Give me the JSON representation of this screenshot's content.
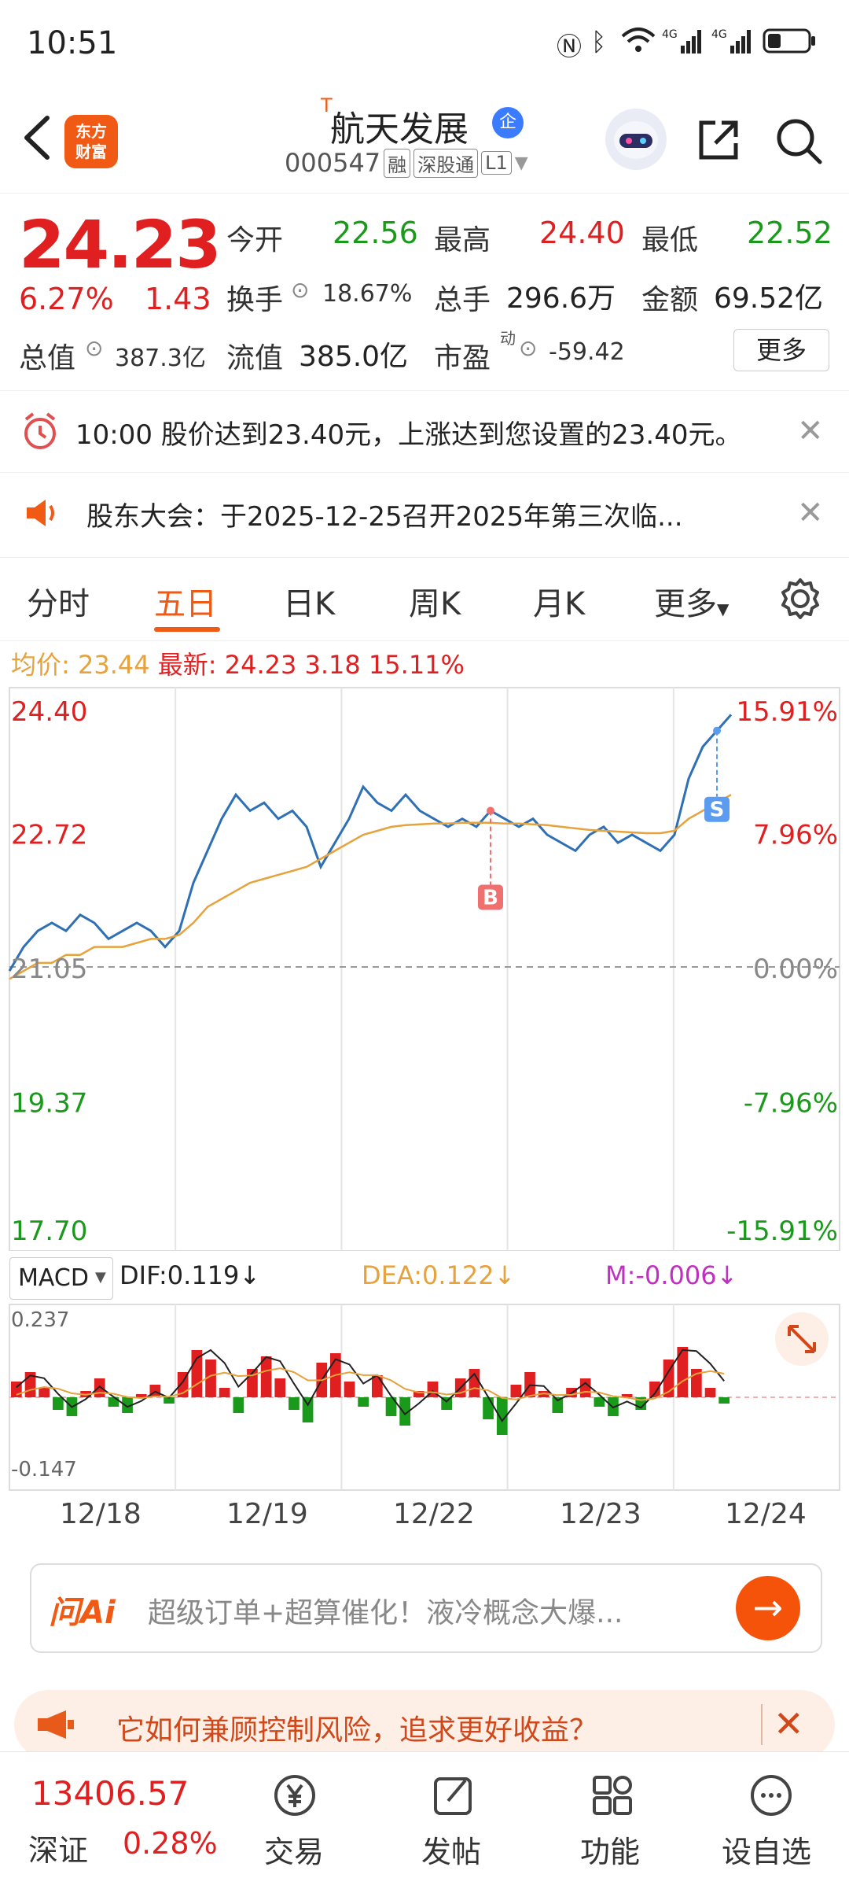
{
  "status_bar": {
    "time": "10:51"
  },
  "header": {
    "title": "航天发展",
    "title_mark": "T",
    "code": "000547",
    "tags": [
      "融",
      "深股通",
      "L1"
    ],
    "logo": "东方财富",
    "corp_badge": "企"
  },
  "quote": {
    "price": "24.23",
    "pct_change": "6.27%",
    "change": "1.43",
    "open_label": "今开",
    "open": "22.56",
    "high_label": "最高",
    "high": "24.40",
    "low_label": "最低",
    "low": "22.52",
    "turnover_label": "换手",
    "turnover": "18.67%",
    "volume_label": "总手",
    "volume": "296.6万",
    "amount_label": "金额",
    "amount": "69.52亿",
    "mktcap_label": "总值",
    "mktcap": "387.3亿",
    "float_label": "流值",
    "float": "385.0亿",
    "pe_label": "市盈",
    "pe_sup": "动",
    "pe": "-59.42",
    "more": "更多"
  },
  "notices": [
    {
      "text": "10:00 股价达到23.40元，上涨达到您设置的23.40元。"
    },
    {
      "text": "股东大会：于2025-12-25召开2025年第三次临..."
    }
  ],
  "tabs": [
    "分时",
    "五日",
    "日K",
    "周K",
    "月K",
    "更多"
  ],
  "chart_info": {
    "avg_label": "均价:",
    "avg": "23.44",
    "latest_label": "最新:",
    "latest": "24.23",
    "change": "3.18",
    "pct": "15.11%"
  },
  "chart_data": {
    "type": "line",
    "title": "",
    "x": [
      "12/18",
      "12/19",
      "12/22",
      "12/23",
      "12/24"
    ],
    "y_ticks_left": [
      "24.40",
      "22.72",
      "21.05",
      "19.37",
      "17.70"
    ],
    "y_ticks_right": [
      "15.91%",
      "7.96%",
      "0.00%",
      "-7.96%",
      "-15.91%"
    ],
    "ylim": [
      17.7,
      24.4
    ],
    "baseline": 21.05,
    "series": [
      {
        "name": "",
        "values": [
          21.0,
          21.3,
          21.5,
          21.6,
          21.5,
          21.7,
          21.6,
          21.4,
          21.5,
          21.6,
          21.5,
          21.3,
          21.5,
          22.1,
          22.5,
          22.9,
          23.2,
          23.0,
          23.1,
          22.9,
          23.0,
          22.8,
          22.3,
          22.6,
          22.9,
          23.3,
          23.1,
          23.0,
          23.2,
          23.0,
          22.9,
          22.8,
          22.9,
          22.8,
          23.0,
          22.9,
          22.8,
          22.9,
          22.7,
          22.6,
          22.5,
          22.7,
          22.8,
          22.6,
          22.7,
          22.6,
          22.5,
          22.7,
          23.4,
          23.8,
          24.0,
          24.2
        ]
      },
      {
        "name": "",
        "values": [
          20.9,
          21.0,
          21.1,
          21.1,
          21.2,
          21.2,
          21.3,
          21.3,
          21.3,
          21.35,
          21.4,
          21.4,
          21.45,
          21.6,
          21.8,
          21.9,
          22.0,
          22.1,
          22.15,
          22.2,
          22.25,
          22.3,
          22.4,
          22.5,
          22.6,
          22.7,
          22.75,
          22.8,
          22.82,
          22.83,
          22.84,
          22.84,
          22.85,
          22.85,
          22.85,
          22.84,
          22.84,
          22.83,
          22.82,
          22.8,
          22.78,
          22.76,
          22.75,
          22.74,
          22.73,
          22.72,
          22.72,
          22.75,
          22.9,
          23.0,
          23.1,
          23.2
        ]
      }
    ],
    "annotations": [
      "B",
      "S"
    ],
    "macd": {
      "label": "MACD",
      "dif_label": "DIF:",
      "dif": "0.119",
      "dea_label": "DEA:",
      "dea": "0.122",
      "m_label": "M:",
      "m": "-0.006",
      "ymax": "0.237",
      "ymin": "-0.147",
      "bars": [
        0.05,
        0.08,
        0.03,
        -0.04,
        -0.06,
        0.02,
        0.06,
        -0.03,
        -0.05,
        0.01,
        0.04,
        -0.02,
        0.08,
        0.15,
        0.12,
        0.03,
        -0.05,
        0.09,
        0.13,
        0.06,
        -0.04,
        -0.08,
        0.11,
        0.14,
        0.05,
        -0.03,
        0.07,
        -0.06,
        -0.09,
        0.02,
        0.05,
        -0.04,
        0.06,
        0.09,
        -0.07,
        -0.12,
        0.04,
        0.08,
        0.02,
        -0.05,
        0.03,
        0.06,
        -0.03,
        -0.06,
        0.01,
        -0.04,
        0.05,
        0.12,
        0.16,
        0.09,
        0.03,
        -0.02
      ]
    }
  },
  "ai_bar": {
    "logo": "问Ai",
    "text": "超级订单+超算催化！液冷概念大爆..."
  },
  "promo": {
    "text": "它如何兼顾控制风险，追求更好收益？"
  },
  "bottom_nav": {
    "index_value": "13406.57",
    "index_name": "深证",
    "index_pct": "0.28%",
    "items": [
      "交易",
      "发帖",
      "功能",
      "设自选"
    ]
  },
  "colors": {
    "accent": "#f05a14",
    "up": "#e02020",
    "down": "#1a9a1a",
    "price_line": "#2e6fb5",
    "avg_line": "#e6a23c"
  }
}
